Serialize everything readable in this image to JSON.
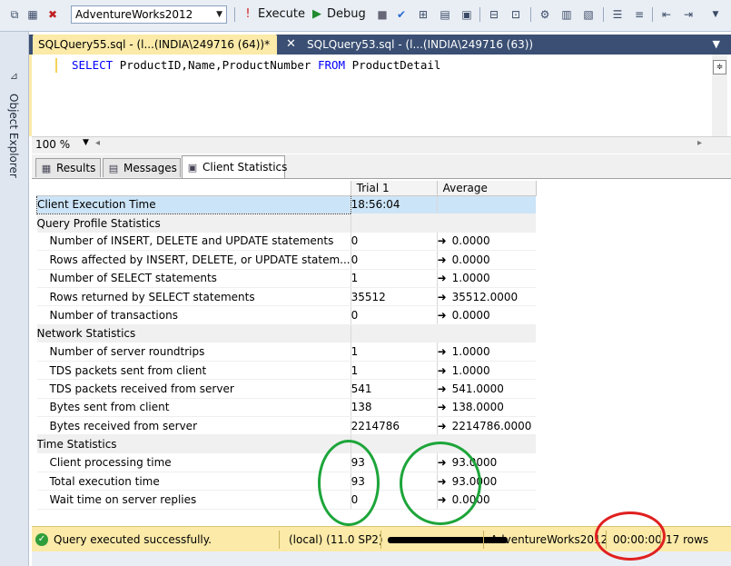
{
  "toolbar": {
    "database": "AdventureWorks2012",
    "execute_label": "Execute",
    "debug_label": "Debug"
  },
  "sidebar": {
    "label": "Object Explorer"
  },
  "tabs": {
    "active": "SQLQuery55.sql - (l...(INDIA\\249716 (64))*",
    "inactive": "SQLQuery53.sql - (l...(INDIA\\249716 (63))"
  },
  "editor": {
    "kw_select": "SELECT",
    "columns": "ProductID,Name,ProductNumber",
    "kw_from": "FROM",
    "table": "ProductDetail"
  },
  "zoom": {
    "level": "100 %"
  },
  "result_tabs": {
    "results": "Results",
    "messages": "Messages",
    "client_stats": "Client Statistics"
  },
  "stats": {
    "headers": {
      "trial": "Trial  1",
      "average": "Average"
    },
    "client_exec": {
      "label": "Client Execution Time",
      "trial": "18:56:04",
      "average": ""
    },
    "sections": {
      "query": "Query Profile Statistics",
      "network": "Network Statistics",
      "time": "Time Statistics"
    },
    "rows": [
      {
        "label": "Number of INSERT, DELETE and UPDATE statements",
        "trial": "0",
        "average": "0.0000"
      },
      {
        "label": "Rows affected by INSERT, DELETE, or UPDATE statem...",
        "trial": "0",
        "average": "0.0000"
      },
      {
        "label": "Number of SELECT statements",
        "trial": "1",
        "average": "1.0000"
      },
      {
        "label": "Rows returned by SELECT statements",
        "trial": "35512",
        "average": "35512.0000"
      },
      {
        "label": "Number of transactions",
        "trial": "0",
        "average": "0.0000"
      },
      {
        "label": "Number of server roundtrips",
        "trial": "1",
        "average": "1.0000"
      },
      {
        "label": "TDS packets sent from client",
        "trial": "1",
        "average": "1.0000"
      },
      {
        "label": "TDS packets received from server",
        "trial": "541",
        "average": "541.0000"
      },
      {
        "label": "Bytes sent from client",
        "trial": "138",
        "average": "138.0000"
      },
      {
        "label": "Bytes received from server",
        "trial": "2214786",
        "average": "2214786.0000"
      },
      {
        "label": "Client processing time",
        "trial": "93",
        "average": "93.0000"
      },
      {
        "label": "Total execution time",
        "trial": "93",
        "average": "93.0000"
      },
      {
        "label": "Wait time on server replies",
        "trial": "0",
        "average": "0.0000"
      }
    ]
  },
  "status": {
    "message": "Query executed successfully.",
    "server": "(local) (11.0 SP2)",
    "database": "AdventureWorks2012",
    "elapsed": "00:00:00",
    "rows": "17 rows"
  },
  "colors": {
    "status_bg": "#fbeaa8",
    "tab_strip": "#3a4f73",
    "highlight": "#cce4f7",
    "circle_green": "#1da53a",
    "circle_red": "#e02020"
  }
}
